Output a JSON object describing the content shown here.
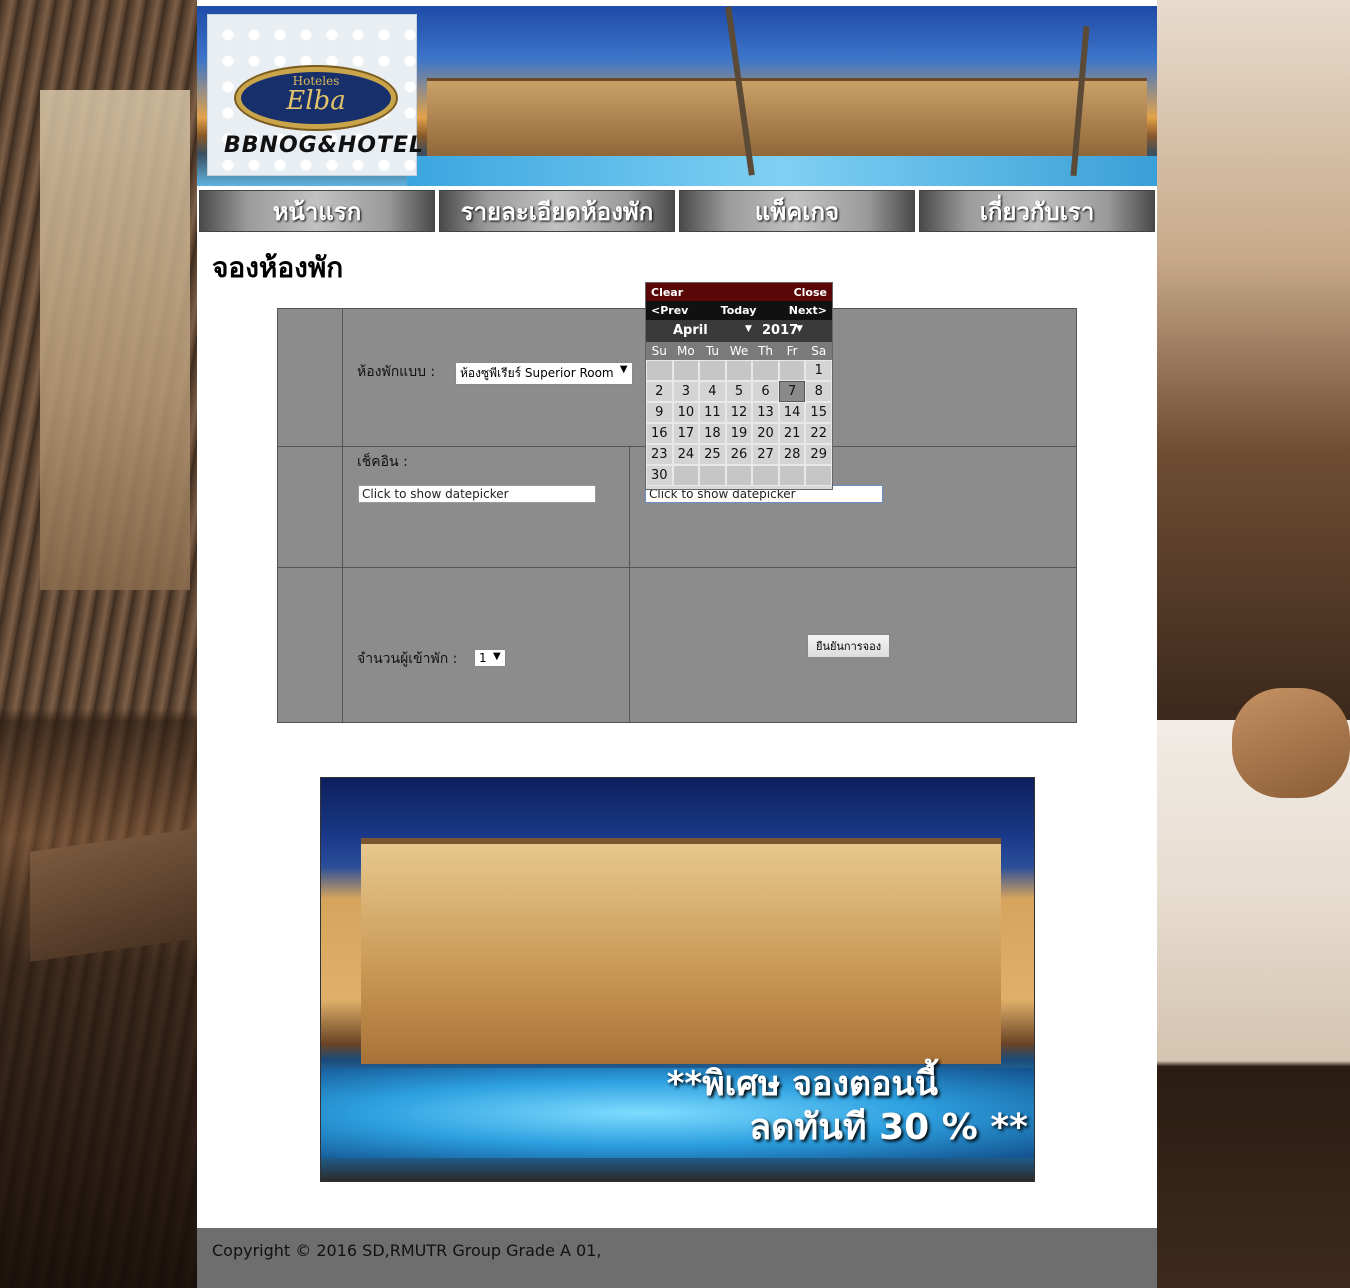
{
  "site": {
    "logo_top": "Hoteles",
    "logo_script": "Elba",
    "logo_name": "BBNOG&HOTEL"
  },
  "nav": [
    {
      "label": "หน้าแรก"
    },
    {
      "label": "รายละเอียดห้องพัก"
    },
    {
      "label": "แพ็คเกจ"
    },
    {
      "label": "เกี่ยวกับเรา"
    }
  ],
  "page_title": "จองห้องพัก",
  "form": {
    "room_type_label": "ห้องพักแบบ :",
    "room_type_value": "ห้องซูพีเรียร์ Superior Room",
    "checkin_label": "เช็คอิน :",
    "checkin_value": "Click to show datepicker",
    "checkout_value": "Click to show datepicker",
    "guests_label": "จำนวนผู้เข้าพัก :",
    "guests_value": "1",
    "confirm_button": "ยืนยันการจอง"
  },
  "datepicker": {
    "clear": "Clear",
    "close": "Close",
    "prev": "<Prev",
    "today": "Today",
    "next": "Next>",
    "month": "April",
    "year": "2017",
    "weekdays": [
      "Su",
      "Mo",
      "Tu",
      "We",
      "Th",
      "Fr",
      "Sa"
    ],
    "leading_blanks": 6,
    "days": [
      "1",
      "2",
      "3",
      "4",
      "5",
      "6",
      "7",
      "8",
      "9",
      "10",
      "11",
      "12",
      "13",
      "14",
      "15",
      "16",
      "17",
      "18",
      "19",
      "20",
      "21",
      "22",
      "23",
      "24",
      "25",
      "26",
      "27",
      "28",
      "29",
      "30"
    ],
    "selected_day": "7"
  },
  "promo": {
    "line1": "**พิเศษ จองตอนนี้",
    "line2": "ลดทันที 30 % **"
  },
  "footer": {
    "copyright": "Copyright © 2016 SD,RMUTR Group Grade A 01,"
  },
  "colors": {
    "datepicker_header": "#5a0707",
    "table_bg": "#8c8c8c",
    "footer_bg": "#6e6e6e"
  }
}
